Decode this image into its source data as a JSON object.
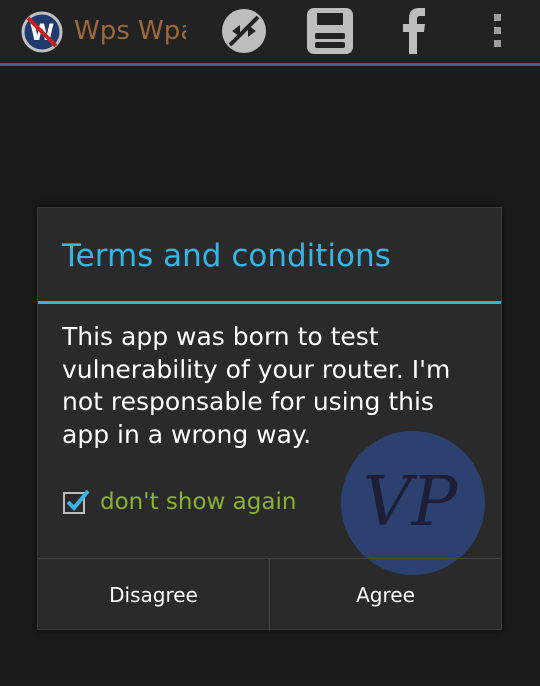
{
  "action_bar": {
    "app_title": "Wps Wpa",
    "accent_color": "#2b6f85",
    "icons": [
      "app-logo-icon",
      "no-connection-icon",
      "save-icon",
      "facebook-icon",
      "overflow-menu-icon"
    ]
  },
  "dialog": {
    "title": "Terms and conditions",
    "message": "This app was born to test vulnerability of your router. I'm not responsable for using this app in a wrong way.",
    "checkbox_label": "don't show again",
    "checkbox_checked": true,
    "disagree_label": "Disagree",
    "agree_label": "Agree",
    "accent_color": "#33b5e5"
  }
}
